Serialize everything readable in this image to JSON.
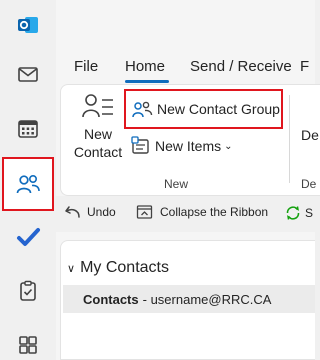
{
  "app": {
    "name": "Outlook"
  },
  "tabs": [
    {
      "label": "File"
    },
    {
      "label": "Home"
    },
    {
      "label": "Send / Receive"
    },
    {
      "label": "F"
    }
  ],
  "ribbon": {
    "new_contact_label_1": "New",
    "new_contact_label_2": "Contact",
    "new_contact_group_label": "New Contact Group",
    "new_items_label": "New Items",
    "group_new_label": "New",
    "cutoff_button_label": "De",
    "cutoff_group_label": "De"
  },
  "quick_access": {
    "undo_label": "Undo",
    "collapse_label": "Collapse the Ribbon",
    "sync_label": "S"
  },
  "folders": {
    "header": "My Contacts",
    "item_name": "Contacts",
    "item_account": "- username@RRC.CA"
  },
  "colors": {
    "accent": "#0f6cbd",
    "highlight": "#e0161e"
  }
}
